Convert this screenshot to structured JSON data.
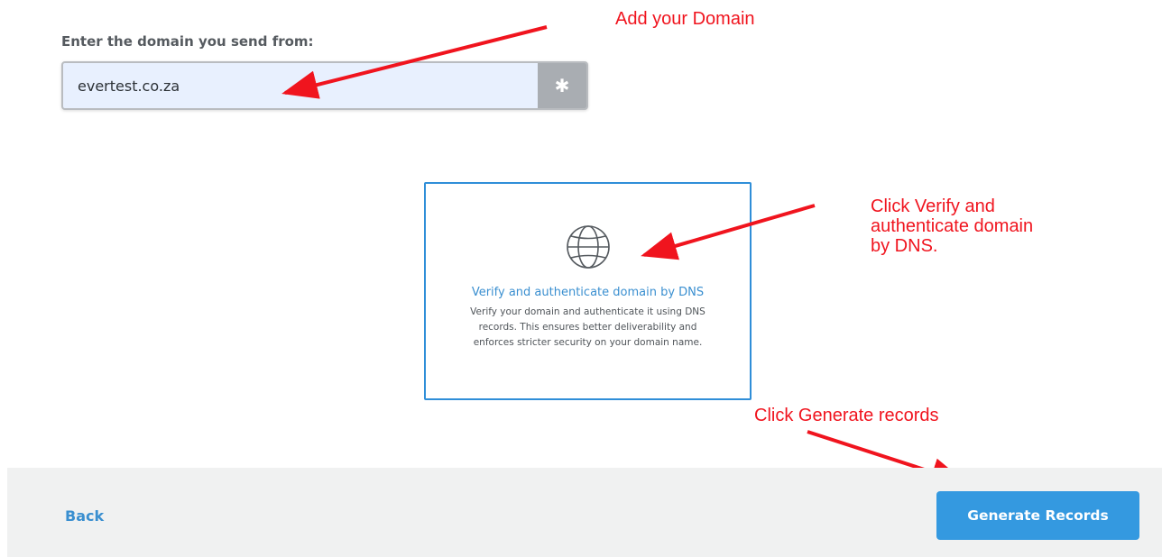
{
  "domain_step": {
    "label": "Enter the domain you send from:",
    "input_value": "evertest.co.za",
    "required_icon": "asterisk-icon"
  },
  "dns_option": {
    "icon": "globe-icon",
    "title": "Verify and authenticate domain by DNS",
    "description_lines": [
      "Verify your domain and authenticate it using DNS",
      "records. This ensures better deliverability and",
      "enforces stricter security on your domain name."
    ]
  },
  "annotations": {
    "add_domain": "Add your Domain",
    "click_verify_lines": [
      "Click Verify and",
      "authenticate domain",
      "by DNS."
    ],
    "click_generate": "Click Generate records"
  },
  "footer": {
    "back_label": "Back",
    "generate_label": "Generate Records"
  },
  "colors": {
    "accent": "#3499e0",
    "annotation": "#f0141e",
    "card_border": "#2f8ed8",
    "input_bg": "#e8f0fe"
  }
}
